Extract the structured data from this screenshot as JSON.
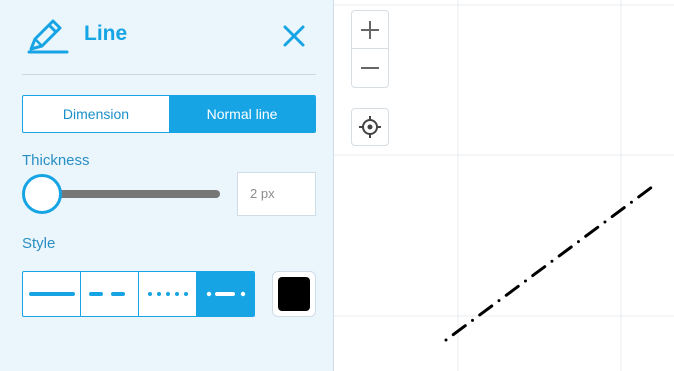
{
  "panel": {
    "title": "Line",
    "modes": [
      "Dimension",
      "Normal line"
    ],
    "active_mode": "Normal line",
    "thickness": {
      "label": "Thickness",
      "value": "2 px",
      "slider_fraction": 0.0
    },
    "style": {
      "label": "Style",
      "options": [
        "solid",
        "dashed",
        "dotted",
        "dash-dot"
      ],
      "active": "dash-dot"
    },
    "color": "#000000",
    "accent_color": "#16a4e4",
    "icons": {
      "title_icon": "pencil-icon",
      "close": "close-icon"
    }
  },
  "canvas": {
    "icons": {
      "zoom_in": "plus-icon",
      "zoom_out": "minus-icon",
      "locate": "crosshair-icon"
    },
    "line_style": "dash-dot"
  }
}
